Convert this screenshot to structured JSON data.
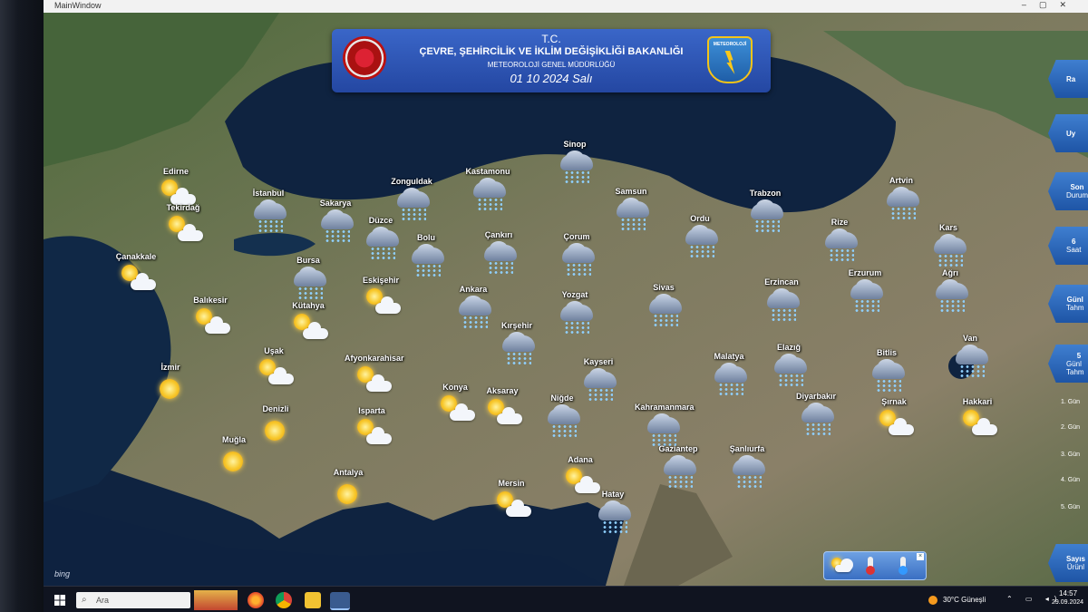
{
  "window": {
    "title": "MainWindow"
  },
  "header": {
    "line1": "T.C.",
    "line2": "ÇEVRE, ŞEHİRCİLİK VE İKLİM DEĞİŞİKLİĞİ BAKANLIĞI",
    "line3": "METEOROLOJİ GENEL MÜDÜRLÜĞÜ",
    "date": "01 10 2024 Salı",
    "logo_text": "METEOROLOJİ"
  },
  "cities": [
    {
      "name": "Edirne",
      "icon": "sun-cloud"
    },
    {
      "name": "Tekirdağ",
      "icon": "sun-cloud"
    },
    {
      "name": "İstanbul",
      "icon": "rain-cloud"
    },
    {
      "name": "Çanakkale",
      "icon": "sun-cloud"
    },
    {
      "name": "Sakarya",
      "icon": "rain-cloud"
    },
    {
      "name": "Zonguldak",
      "icon": "rain-cloud"
    },
    {
      "name": "Düzce",
      "icon": "rain-cloud"
    },
    {
      "name": "Kastamonu",
      "icon": "rain-cloud"
    },
    {
      "name": "Sinop",
      "icon": "rain-cloud"
    },
    {
      "name": "Samsun",
      "icon": "rain-cloud"
    },
    {
      "name": "Bolu",
      "icon": "rain-cloud"
    },
    {
      "name": "Çankırı",
      "icon": "rain-cloud"
    },
    {
      "name": "Çorum",
      "icon": "rain-cloud"
    },
    {
      "name": "Ordu",
      "icon": "rain-cloud"
    },
    {
      "name": "Trabzon",
      "icon": "rain-cloud"
    },
    {
      "name": "Rize",
      "icon": "rain-cloud"
    },
    {
      "name": "Artvin",
      "icon": "rain-cloud"
    },
    {
      "name": "Kars",
      "icon": "rain-cloud"
    },
    {
      "name": "Bursa",
      "icon": "rain-cloud"
    },
    {
      "name": "Balıkesir",
      "icon": "sun-cloud"
    },
    {
      "name": "Kütahya",
      "icon": "sun-cloud"
    },
    {
      "name": "Eskişehir",
      "icon": "sun-cloud"
    },
    {
      "name": "Ankara",
      "icon": "rain-cloud"
    },
    {
      "name": "Yozgat",
      "icon": "rain-cloud"
    },
    {
      "name": "Sivas",
      "icon": "rain-cloud"
    },
    {
      "name": "Erzincan",
      "icon": "rain-cloud"
    },
    {
      "name": "Erzurum",
      "icon": "rain-cloud"
    },
    {
      "name": "Ağrı",
      "icon": "rain-cloud"
    },
    {
      "name": "Kırşehir",
      "icon": "rain-cloud"
    },
    {
      "name": "İzmir",
      "icon": "sun"
    },
    {
      "name": "Uşak",
      "icon": "sun-cloud"
    },
    {
      "name": "Afyonkarahisar",
      "icon": "sun-cloud"
    },
    {
      "name": "Kayseri",
      "icon": "rain-cloud"
    },
    {
      "name": "Malatya",
      "icon": "rain-cloud"
    },
    {
      "name": "Elazığ",
      "icon": "rain-cloud"
    },
    {
      "name": "Bitlis",
      "icon": "rain-cloud"
    },
    {
      "name": "Van",
      "icon": "rain-cloud"
    },
    {
      "name": "Denizli",
      "icon": "sun"
    },
    {
      "name": "Isparta",
      "icon": "sun-cloud"
    },
    {
      "name": "Konya",
      "icon": "sun-cloud"
    },
    {
      "name": "Aksaray",
      "icon": "sun-cloud"
    },
    {
      "name": "Niğde",
      "icon": "rain-cloud"
    },
    {
      "name": "Kahramanmara",
      "icon": "rain-cloud"
    },
    {
      "name": "Diyarbakır",
      "icon": "rain-cloud"
    },
    {
      "name": "Şırnak",
      "icon": "sun-cloud"
    },
    {
      "name": "Hakkari",
      "icon": "sun-cloud"
    },
    {
      "name": "Muğla",
      "icon": "sun"
    },
    {
      "name": "Adana",
      "icon": "sun-cloud"
    },
    {
      "name": "Gaziantep",
      "icon": "rain-cloud"
    },
    {
      "name": "Şanlıurfa",
      "icon": "rain-cloud"
    },
    {
      "name": "Antalya",
      "icon": "sun"
    },
    {
      "name": "Mersin",
      "icon": "sun-cloud"
    },
    {
      "name": "Hatay",
      "icon": "rain-cloud"
    }
  ],
  "sidebar": [
    {
      "line1": "Ra",
      "line2": ""
    },
    {
      "line1": "Uy",
      "line2": ""
    },
    {
      "line1": "Son",
      "line2": "Durum"
    },
    {
      "line1": "6",
      "line2": "Saat"
    },
    {
      "line1": "Günl",
      "line2": "Tahm"
    },
    {
      "line1": "5",
      "line2": "Günl Tahm"
    },
    {
      "line1": "Sayıs",
      "line2": "Ürünl"
    }
  ],
  "days": [
    "1. Gün",
    "2. Gün",
    "3. Gün",
    "4. Gün",
    "5. Gün"
  ],
  "map_attribution": "bing",
  "taskbar": {
    "search_placeholder": "Ara",
    "weather": "30°C Güneşli",
    "time": "14:57",
    "date": "29.09.2024"
  },
  "colors": {
    "header": "#2f56b4",
    "sea": "#0f2340",
    "land": "#5f6b4c",
    "sidebar": "#2a68bd"
  }
}
